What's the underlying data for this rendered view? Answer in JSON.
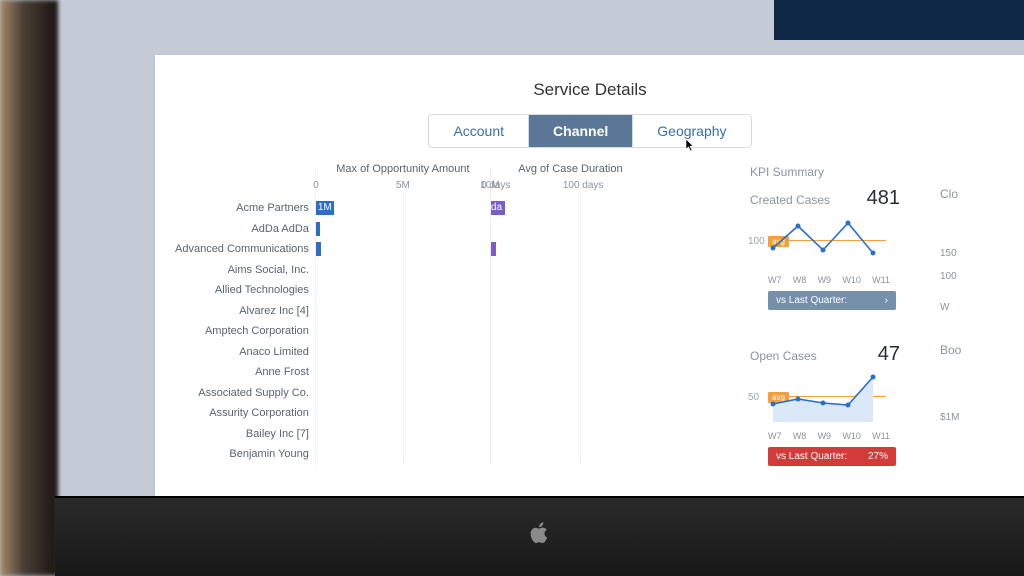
{
  "page_title": "Service Details",
  "tabs": {
    "account": "Account",
    "channel": "Channel",
    "geography": "Geography",
    "active": "channel"
  },
  "opp_chart_title": "Max of Opportunity Amount",
  "opp_axis": {
    "a0": "0",
    "a1": "5M",
    "a2": "10M"
  },
  "dur_chart_title": "Avg of Case Duration",
  "dur_axis": {
    "a0": "0 days",
    "a1": "100 days"
  },
  "accounts": {
    "r0": "Acme Partners",
    "r1": "AdDa AdDa",
    "r2": "Advanced Communications",
    "r3": "Aims Social, Inc.",
    "r4": "Allied Technologies",
    "r5": "Alvarez Inc [4]",
    "r6": "Amptech Corporation",
    "r7": "Anaco Limited",
    "r8": "Anne Frost",
    "r9": "Associated Supply Co.",
    "r10": "Assurity Corporation",
    "r11": "Bailey Inc [7]",
    "r12": "Benjamin Young"
  },
  "bar_labels": {
    "opp0": "1M",
    "dur0": "da"
  },
  "kpi": {
    "title": "KPI Summary",
    "created": {
      "label": "Created Cases",
      "value": "481",
      "y": "100",
      "avg": "avg"
    },
    "closed": {
      "label": "Clo",
      "y": "150",
      "y2": "100"
    },
    "open": {
      "label": "Open Cases",
      "value": "47",
      "y": "50",
      "avg": "avg"
    },
    "booking": {
      "label": "Boo",
      "y": "$1M"
    },
    "x": {
      "w7": "W7",
      "w8": "W8",
      "w9": "W9",
      "w10": "W10",
      "w11": "W11",
      "w_cut": "W"
    },
    "vs_label": "vs Last Quarter:",
    "vs_open_pct": "27%"
  },
  "chart_data": [
    {
      "type": "bar",
      "title": "Max of Opportunity Amount",
      "orientation": "horizontal",
      "xlabel": "",
      "ylabel": "",
      "xlim": [
        0,
        10000000
      ],
      "x_ticks": [
        0,
        5000000,
        10000000
      ],
      "x_tick_labels": [
        "0",
        "5M",
        "10M"
      ],
      "categories": [
        "Acme Partners",
        "AdDa AdDa",
        "Advanced Communications",
        "Aims Social, Inc.",
        "Allied Technologies",
        "Alvarez Inc [4]",
        "Amptech Corporation",
        "Anaco Limited",
        "Anne Frost",
        "Associated Supply Co.",
        "Assurity Corporation",
        "Bailey Inc [7]",
        "Benjamin Young"
      ],
      "values": [
        1000000,
        200000,
        250000,
        null,
        null,
        null,
        null,
        null,
        null,
        null,
        null,
        null,
        null
      ],
      "color": "#2c6ec9"
    },
    {
      "type": "bar",
      "title": "Avg of Case Duration",
      "orientation": "horizontal",
      "xlabel": "days",
      "ylabel": "",
      "xlim": [
        0,
        150
      ],
      "x_ticks": [
        0,
        100
      ],
      "x_tick_labels": [
        "0 days",
        "100 days"
      ],
      "categories": [
        "Acme Partners",
        "AdDa AdDa",
        "Advanced Communications",
        "Aims Social, Inc.",
        "Allied Technologies",
        "Alvarez Inc [4]",
        "Amptech Corporation",
        "Anaco Limited",
        "Anne Frost",
        "Associated Supply Co.",
        "Assurity Corporation",
        "Bailey Inc [7]",
        "Benjamin Young"
      ],
      "values": [
        10,
        null,
        4,
        null,
        null,
        null,
        null,
        null,
        null,
        null,
        null,
        null,
        null
      ],
      "color": "#7c5cc9"
    },
    {
      "type": "line",
      "title": "Created Cases",
      "total": 481,
      "x": [
        "W7",
        "W8",
        "W9",
        "W10",
        "W11"
      ],
      "y": [
        90,
        120,
        85,
        125,
        80
      ],
      "avg": 100,
      "ylim": [
        60,
        140
      ],
      "vs_last_quarter": null
    },
    {
      "type": "line",
      "title": "Open Cases",
      "total": 47,
      "x": [
        "W7",
        "W8",
        "W9",
        "W10",
        "W11"
      ],
      "y": [
        45,
        50,
        46,
        44,
        70
      ],
      "avg": 50,
      "ylim": [
        30,
        75
      ],
      "vs_last_quarter": "27%"
    }
  ]
}
